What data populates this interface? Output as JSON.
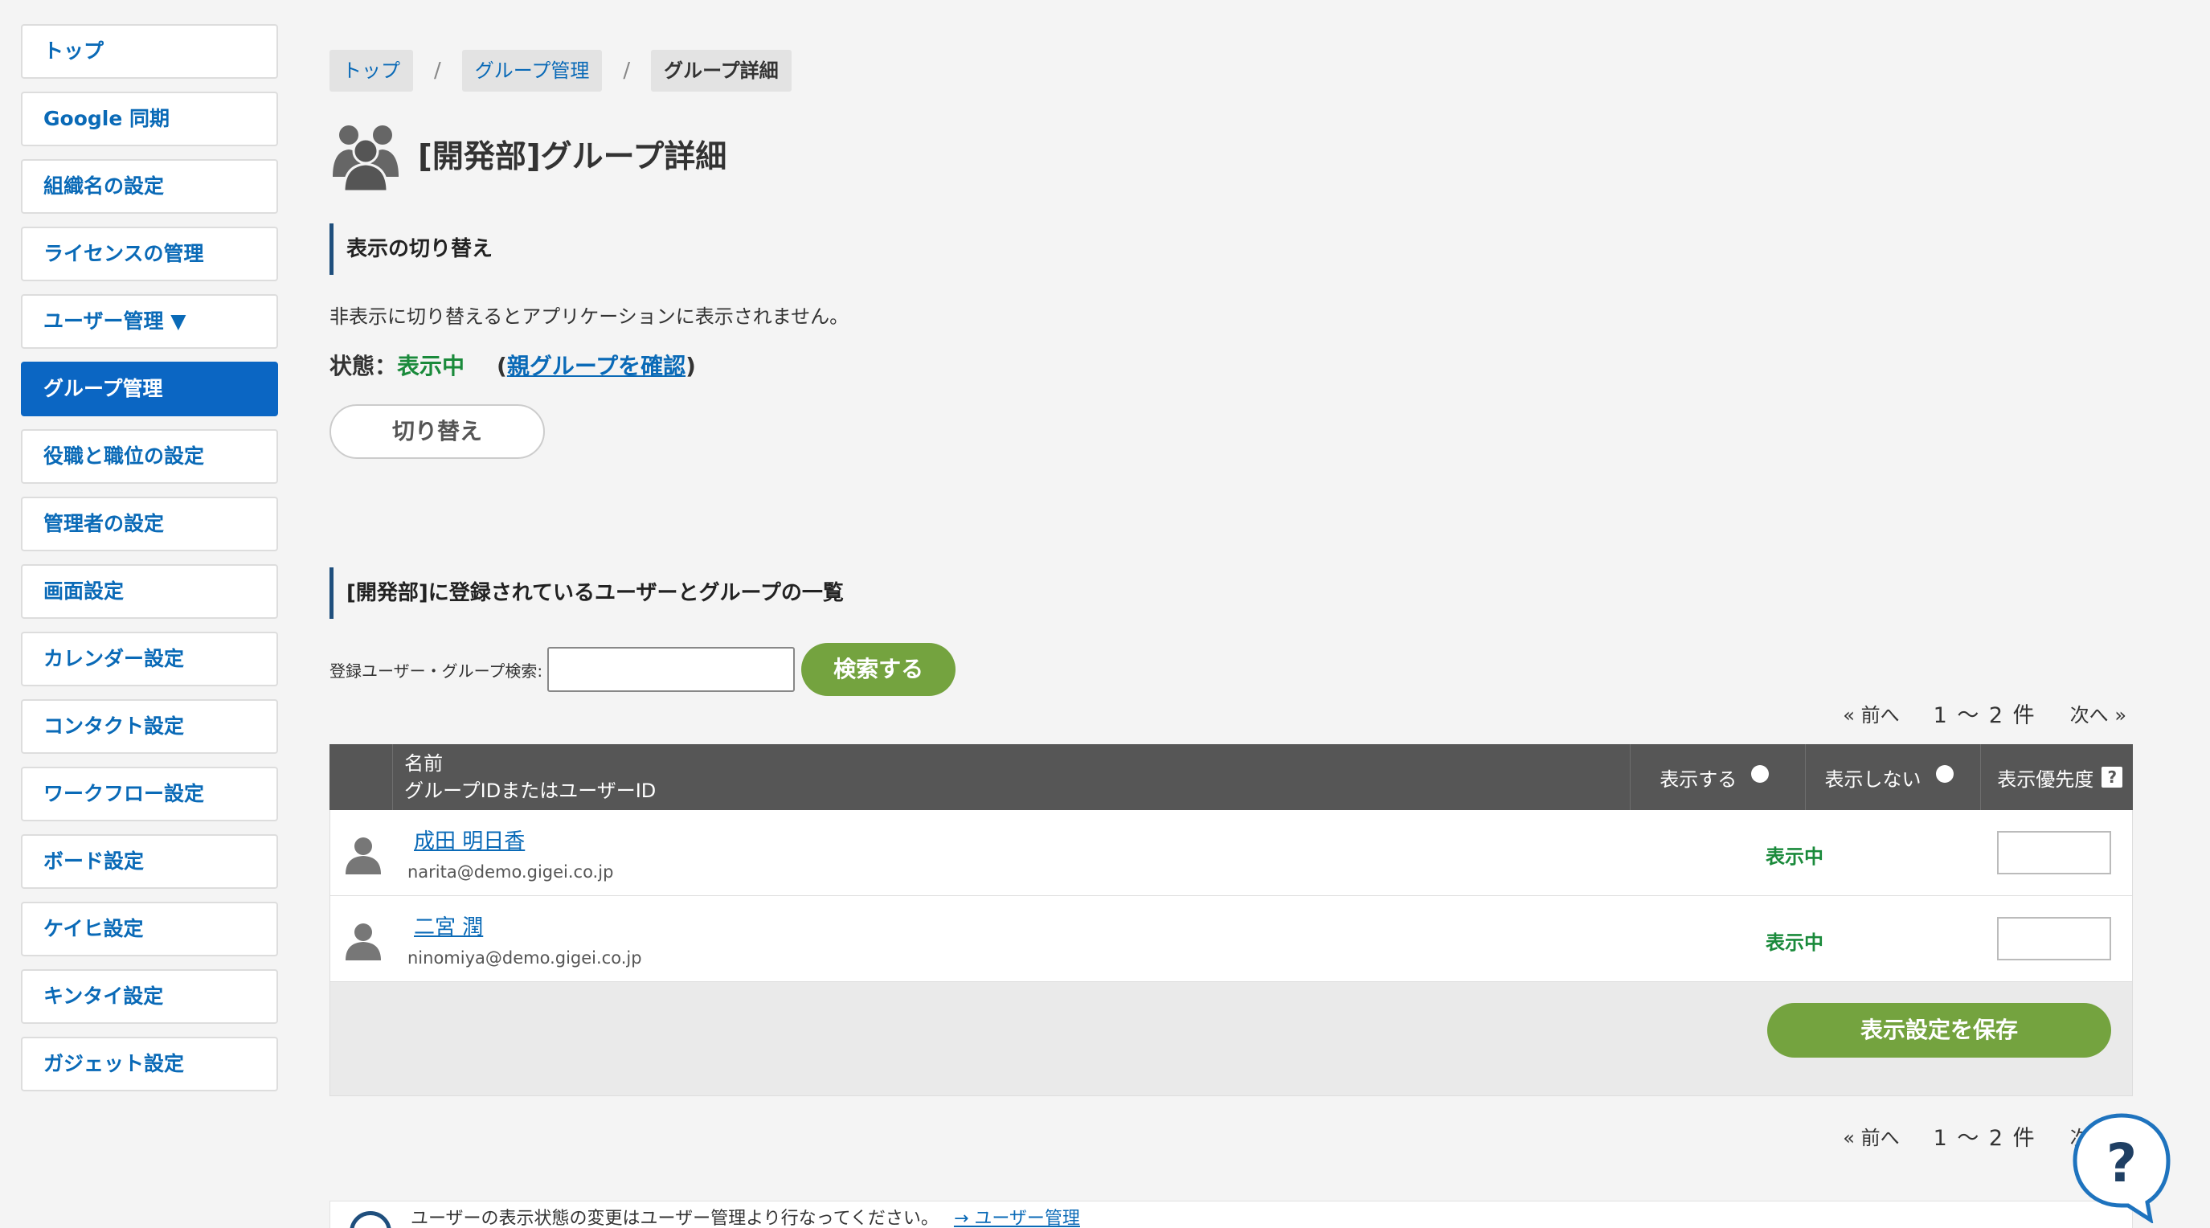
{
  "sidebar": {
    "items": [
      {
        "label": "トップ"
      },
      {
        "label": "Google 同期"
      },
      {
        "label": "組織名の設定"
      },
      {
        "label": "ライセンスの管理"
      },
      {
        "label": "ユーザー管理 ▼"
      },
      {
        "label": "グループ管理",
        "active": true
      },
      {
        "label": "役職と職位の設定"
      },
      {
        "label": "管理者の設定"
      },
      {
        "label": "画面設定"
      },
      {
        "label": "カレンダー設定"
      },
      {
        "label": "コンタクト設定"
      },
      {
        "label": "ワークフロー設定"
      },
      {
        "label": "ボード設定"
      },
      {
        "label": "ケイヒ設定"
      },
      {
        "label": "キンタイ設定"
      },
      {
        "label": "ガジェット設定"
      }
    ]
  },
  "breadcrumb": [
    "トップ",
    "グループ管理",
    "グループ詳細"
  ],
  "breadcrumb_sep": "/",
  "page_title": "[開発部]グループ詳細",
  "toggle_section": {
    "heading": "表示の切り替え",
    "description": "非表示に切り替えるとアプリケーションに表示されません。",
    "status_label": "状態：",
    "status_value": "表示中",
    "paren_open": "(",
    "parent_link": "親グループを確認",
    "paren_close": ")",
    "button": "切り替え"
  },
  "list_section": {
    "heading": "[開発部]に登録されているユーザーとグループの一覧",
    "search_label": "登録ユーザー・グループ検索:",
    "search_value": "",
    "search_button": "検索する"
  },
  "pager": {
    "prev": "« 前へ",
    "range": "1 〜 2 件",
    "next": "次へ »"
  },
  "table": {
    "headers": {
      "name": "名前",
      "id": "グループIDまたはユーザーID",
      "show": "表示する",
      "hide": "表示しない",
      "priority": "表示優先度",
      "help": "?"
    },
    "rows": [
      {
        "name": "成田 明日香",
        "email": "narita@demo.gigei.co.jp",
        "status": "表示中",
        "priority": ""
      },
      {
        "name": "二宮 潤",
        "email": "ninomiya@demo.gigei.co.jp",
        "status": "表示中",
        "priority": ""
      }
    ],
    "save_button": "表示設定を保存"
  },
  "info": {
    "text": "ユーザーの表示状態の変更はユーザー管理より行なってください。",
    "link": "→ ユーザー管理"
  },
  "help_button": "?",
  "colors": {
    "accent": "#0b66c3",
    "green_button": "#74a33f",
    "status_green": "#1a8a3b",
    "header_dark": "#565656"
  }
}
